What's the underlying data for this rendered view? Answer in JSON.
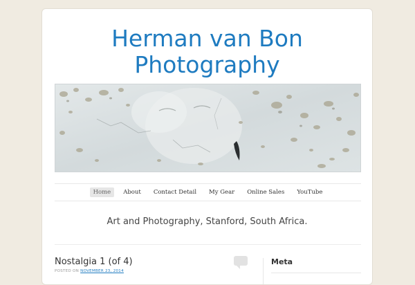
{
  "site": {
    "title_line1": "Herman van Bon",
    "title_line2": "Photography",
    "tagline": "Art and Photography, Stanford, South Africa."
  },
  "header_image": {
    "description_icon": "weathered-wall-image"
  },
  "nav": {
    "items": [
      {
        "label": "Home",
        "active": true
      },
      {
        "label": "About",
        "active": false
      },
      {
        "label": "Contact Detail",
        "active": false
      },
      {
        "label": "My Gear",
        "active": false
      },
      {
        "label": "Online Sales",
        "active": false
      },
      {
        "label": "YouTube",
        "active": false
      }
    ]
  },
  "post": {
    "title": "Nostalgia 1 (of 4)",
    "meta_prefix": "POSTED ON ",
    "date": "NOVEMBER 23, 2014",
    "comment_icon": "comment-bubble-icon"
  },
  "sidebar": {
    "widget_title": "Meta"
  },
  "colors": {
    "background": "#f0ebe1",
    "title_blue": "#1e7bc0",
    "page": "#ffffff",
    "nav_active_bg": "#e6e6e6"
  }
}
